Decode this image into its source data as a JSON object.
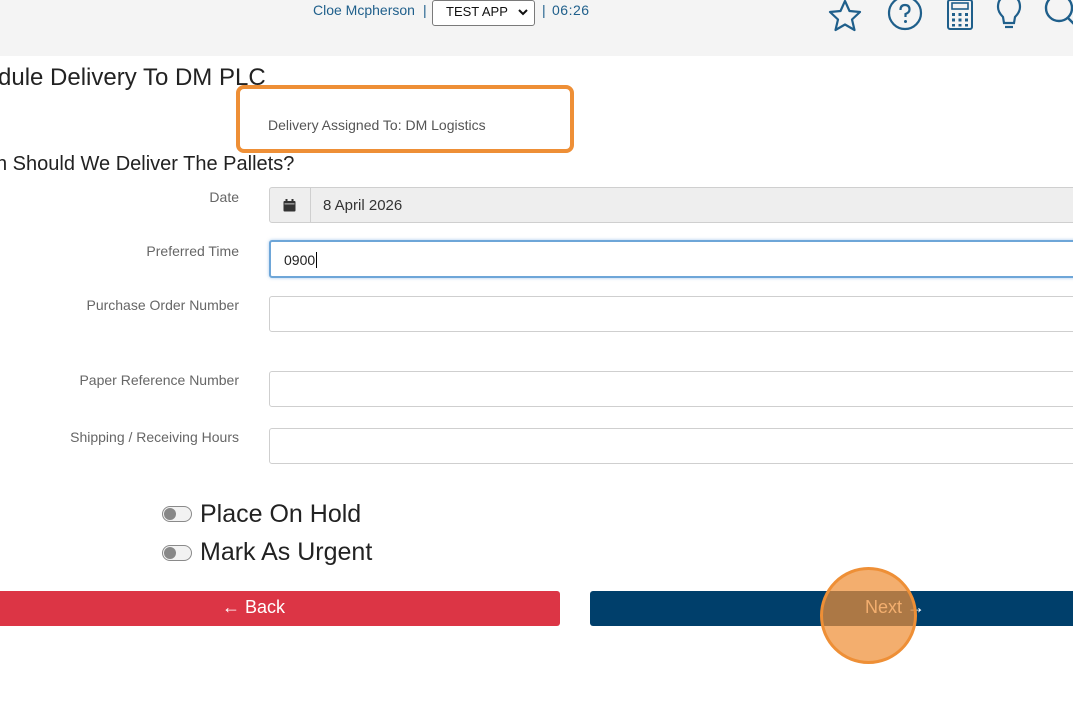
{
  "header": {
    "user_name": "Cloe Mcpherson",
    "separator": "|",
    "app_selected": "TEST APP",
    "clock": "06:26",
    "icons": [
      "star-icon",
      "help-icon",
      "calculator-icon",
      "lightbulb-icon",
      "search-icon"
    ],
    "icon_color": "#1f5f8b"
  },
  "page": {
    "title": "dule Delivery To DM PLC",
    "assigned_text": "Delivery Assigned To: DM Logistics",
    "section_title": "n Should We Deliver The Pallets?"
  },
  "form": {
    "date_label": "Date",
    "date_value": "8 April 2026",
    "preferred_time_label": "Preferred Time",
    "preferred_time_value": "0900",
    "po_label": "Purchase Order Number",
    "po_value": "",
    "paper_ref_label": "Paper Reference Number",
    "paper_ref_value": "",
    "shipping_hours_label": "Shipping / Receiving Hours",
    "shipping_hours_value": ""
  },
  "toggles": {
    "place_on_hold": "Place On Hold",
    "place_on_hold_on": false,
    "mark_urgent": "Mark As Urgent",
    "mark_urgent_on": false
  },
  "buttons": {
    "back": "← Back",
    "next": "Next →"
  },
  "colors": {
    "highlight": "#ee8f36",
    "back_button": "#dc3545",
    "next_button": "#003f6b"
  }
}
